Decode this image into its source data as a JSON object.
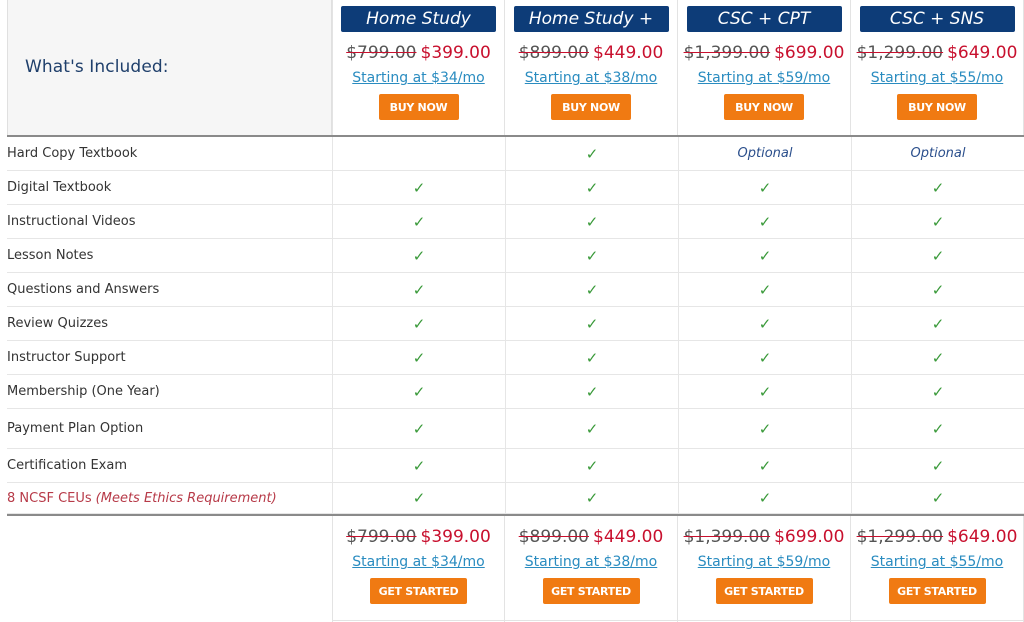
{
  "header": {
    "label": "What's Included:"
  },
  "plans": [
    {
      "name": "Home Study",
      "old_price": "$799.00",
      "new_price": "$399.00",
      "monthly": "Starting at $34/mo",
      "buy_label": "BUY NOW",
      "start_label": "GET STARTED"
    },
    {
      "name": "Home Study +",
      "old_price": "$899.00",
      "new_price": "$449.00",
      "monthly": "Starting at $38/mo",
      "buy_label": "BUY NOW",
      "start_label": "GET STARTED"
    },
    {
      "name": "CSC + CPT",
      "old_price": "$1,399.00",
      "new_price": "$699.00",
      "monthly": "Starting at $59/mo",
      "buy_label": "BUY NOW",
      "start_label": "GET STARTED"
    },
    {
      "name": "CSC + SNS",
      "old_price": "$1,299.00",
      "new_price": "$649.00",
      "monthly": "Starting at $55/mo",
      "buy_label": "BUY NOW",
      "start_label": "GET STARTED"
    }
  ],
  "features": [
    {
      "label": "Hard Copy Textbook",
      "values": [
        "",
        "check",
        "Optional",
        "Optional"
      ]
    },
    {
      "label": "Digital Textbook",
      "values": [
        "check",
        "check",
        "check",
        "check"
      ]
    },
    {
      "label": "Instructional Videos",
      "values": [
        "check",
        "check",
        "check",
        "check"
      ]
    },
    {
      "label": "Lesson Notes",
      "values": [
        "check",
        "check",
        "check",
        "check"
      ]
    },
    {
      "label": "Questions and Answers",
      "values": [
        "check",
        "check",
        "check",
        "check"
      ]
    },
    {
      "label": "Review Quizzes",
      "values": [
        "check",
        "check",
        "check",
        "check"
      ]
    },
    {
      "label": "Instructor Support",
      "values": [
        "check",
        "check",
        "check",
        "check"
      ]
    },
    {
      "label": "Membership (One Year)",
      "values": [
        "check",
        "check",
        "check",
        "check"
      ]
    },
    {
      "label": "Payment Plan Option",
      "values": [
        "check",
        "check",
        "check",
        "check"
      ]
    },
    {
      "label": "Certification Exam",
      "values": [
        "check",
        "check",
        "check",
        "check"
      ]
    },
    {
      "label": "8 NCSF CEUs",
      "note": "(Meets Ethics Requirement)",
      "values": [
        "check",
        "check",
        "check",
        "check"
      ]
    }
  ],
  "symbols": {
    "check": "✓"
  },
  "colors": {
    "title_bg": "#0d3c78",
    "button": "#f07a12",
    "sale_price": "#c8102e",
    "link": "#2a8cc0",
    "check": "#3a9a3a"
  }
}
